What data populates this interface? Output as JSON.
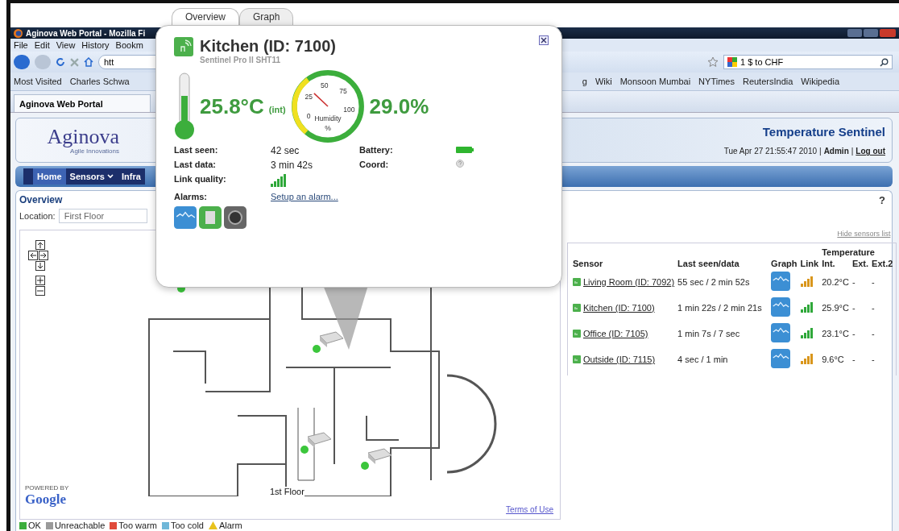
{
  "browser": {
    "title": "Aginova Web Portal - Mozilla Fi",
    "menu": [
      "File",
      "Edit",
      "View",
      "History",
      "Bookm"
    ],
    "address": "htt",
    "search": "1 $ to CHF",
    "bookmarks_left": [
      "Most Visited",
      "Charles Schwa"
    ],
    "bookmarks_right": [
      "g",
      "Wiki",
      "Monsoon Mumbai",
      "NYTimes",
      "ReutersIndia",
      "Wikipedia"
    ],
    "tab": "Aginova Web Portal"
  },
  "header": {
    "logo": "Aginova",
    "tagline": "Agile Innovations",
    "product": "Temperature Sentinel",
    "datetime": "Tue Apr 27 21:55:47 2010",
    "separator": "|",
    "user": "Admin",
    "logout": "Log out"
  },
  "nav": [
    {
      "label": "Home",
      "selected": true,
      "dropdown": false
    },
    {
      "label": "Sensors",
      "selected": false,
      "dropdown": true
    },
    {
      "label": "Infra",
      "selected": false,
      "dropdown": false
    }
  ],
  "overview": {
    "title": "Overview",
    "help": "?",
    "location_label": "Location:",
    "location_value": "First Floor",
    "map": {
      "floor_label": "1st Floor",
      "powered_by": "POWERED BY",
      "provider": "Google",
      "terms": "Terms of Use"
    },
    "hide_link": "Hide sensors list",
    "table": {
      "group_header": "Temperature",
      "columns": [
        "Sensor",
        "Last seen/data",
        "Graph",
        "Link",
        "Int.",
        "Ext.",
        "Ext.2"
      ],
      "rows": [
        {
          "sensor": "Living Room (ID: 7092)",
          "seen": "55 sec / 2 min 52s",
          "color": "#d9961c",
          "int": "20.2°C",
          "ext": "-",
          "ext2": "-"
        },
        {
          "sensor": "Kitchen (ID: 7100)",
          "seen": "1 min 22s / 2 min 21s",
          "color": "#2fa83a",
          "int": "25.9°C",
          "ext": "-",
          "ext2": "-"
        },
        {
          "sensor": "Office (ID: 7105)",
          "seen": "1 min 7s / 7 sec",
          "color": "#2fa83a",
          "int": "23.1°C",
          "ext": "-",
          "ext2": "-"
        },
        {
          "sensor": "Outside (ID: 7115)",
          "seen": "4 sec / 1 min",
          "color": "#d9961c",
          "int": "9.6°C",
          "ext": "-",
          "ext2": "-"
        }
      ]
    }
  },
  "legend": [
    {
      "label": "OK",
      "kind": "square",
      "color": "#3cae3c"
    },
    {
      "label": "Unreachable",
      "kind": "square",
      "color": "#9a9a9a"
    },
    {
      "label": "Too warm",
      "kind": "square",
      "color": "#e04a3a"
    },
    {
      "label": "Too cold",
      "kind": "square",
      "color": "#6fb7d8"
    },
    {
      "label": "Alarm",
      "kind": "warning",
      "color": "#e8c21c"
    }
  ],
  "popup": {
    "tabs": [
      {
        "label": "Overview",
        "selected": true
      },
      {
        "label": "Graph",
        "selected": false
      }
    ],
    "title": "Kitchen (ID: 7100)",
    "subtitle": "Sentinel Pro II SHT11",
    "temperature": "25.8°C",
    "temperature_note": "(int)",
    "gauge": {
      "labels": [
        "0",
        "25",
        "50",
        "75",
        "100"
      ],
      "caption": "Humidity",
      "unit": "%"
    },
    "humidity": "29.0%",
    "details": [
      [
        {
          "label": "Last seen:",
          "kind": "text",
          "value": "42 sec"
        },
        {
          "label": "Battery:",
          "kind": "battery"
        }
      ],
      [
        {
          "label": "Last data:",
          "kind": "text",
          "value": "3 min 42s"
        },
        {
          "label": "Coord:",
          "kind": "help"
        }
      ],
      [
        {
          "label": "Link quality:",
          "kind": "signal"
        }
      ],
      [
        {
          "label": "Alarms:",
          "kind": "link",
          "value": "Setup an alarm..."
        }
      ]
    ]
  }
}
